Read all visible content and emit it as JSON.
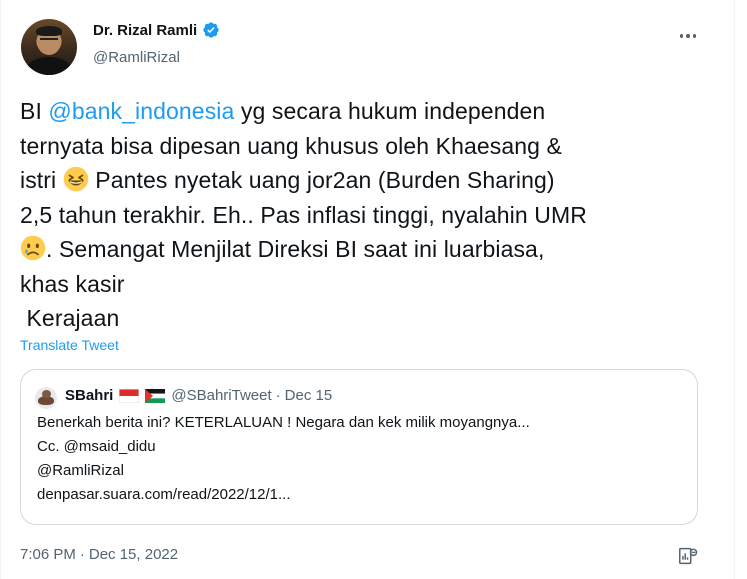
{
  "author": {
    "name": "Dr. Rizal Ramli",
    "handle": "@RamliRizal",
    "verified": true
  },
  "tweet": {
    "lines": {
      "l1_pre": "BI ",
      "l1_mention": "@bank_indonesia",
      "l1_post": " yg secara hukum independen",
      "l2": "ternyata bisa dipesan uang khusus oleh Khaesang &",
      "l3_pre": "istri ",
      "l3_post": " Pantes nyetak uang jor2an (Burden Sharing)",
      "l4": "2,5 tahun terakhir. Eh.. Pas inflasi tinggi, nyalahin UMR",
      "l5_post": ". Semangat Menjilat Direksi BI saat ini luarbiasa,",
      "l6": "khas kasir",
      "l7": " Kerajaan"
    },
    "translate_label": "Translate Tweet",
    "time": "7:06 PM",
    "date": "Dec 15, 2022",
    "separator": "·"
  },
  "quote": {
    "name": "SBahri",
    "handle": "@SBahriTweet",
    "dot": "·",
    "date": "Dec 15",
    "lines": [
      "Benerkah berita ini? KETERLALUAN ! Negara dan kek milik moyangnya...",
      "Cc. @msaid_didu",
      "@RamliRizal",
      "denpasar.suara.com/read/2022/12/1..."
    ]
  },
  "icons": {
    "verified": "verified-badge-icon",
    "more": "more-options-icon",
    "analytics": "analytics-icon",
    "emoji1": "grinning-squinting-emoji",
    "emoji2": "sad-tear-emoji",
    "flag1": "indonesia-flag",
    "flag2": "palestine-flag"
  },
  "colors": {
    "accent": "#1d9bf0",
    "text": "#0f1419",
    "secondary": "#536471",
    "border": "#cfd9de"
  }
}
